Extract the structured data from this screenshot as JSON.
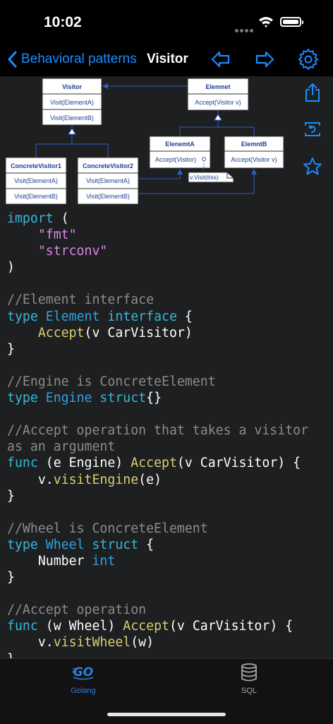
{
  "status_bar": {
    "time": "10:02"
  },
  "navbar": {
    "back_label": "Behavioral patterns",
    "title": "Visitor"
  },
  "diagram": {
    "visitor": {
      "name": "Visitor",
      "methods": [
        "Visit(ElementA)",
        "Visit(ElementB)"
      ]
    },
    "element": {
      "name": "Elemnet",
      "methods": [
        "Accept(Visitor v)"
      ]
    },
    "concrete_visitor1": {
      "name": "ConcreteVisitor1",
      "methods": [
        "Visit(ElementA)",
        "Visit(ElementB)"
      ]
    },
    "concrete_visitor2": {
      "name": "ConcreteVisitor2",
      "methods": [
        "Visit(ElementA)",
        "Visit(ElementB)"
      ]
    },
    "element_a": {
      "name": "ElenemtA",
      "methods": [
        "Accept(Visitor)"
      ]
    },
    "element_b": {
      "name": "ElemntB",
      "methods": [
        "Accept(Visitor v)"
      ]
    },
    "note": "v.Visit(this)"
  },
  "code": {
    "l1_kw": "import",
    "l1_rest": " (",
    "l2": "\"fmt\"",
    "l3": "\"strconv\"",
    "l4": ")",
    "l6": "//Element interface",
    "l7_kw": "type",
    "l7_name": "Element",
    "l7_kw2": "interface",
    "l7_rest": " {",
    "l8_fn": "Accept",
    "l8_rest": "(v CarVisitor)",
    "l9": "}",
    "l11": "//Engine is ConcreteElement",
    "l12_kw": "type",
    "l12_name": "Engine",
    "l12_kw2": "struct",
    "l12_rest": "{}",
    "l14": "//Accept operation that takes a visitor",
    "l15": "as an argument",
    "l16_kw": "func",
    "l16_a": " (e Engine) ",
    "l16_fn": "Accept",
    "l16_b": "(v CarVisitor) {",
    "l17_a": "v.",
    "l17_fn": "visitEngine",
    "l17_b": "(e)",
    "l18": "}",
    "l20": "//Wheel is ConcreteElement",
    "l21_kw": "type",
    "l21_name": "Wheel",
    "l21_kw2": "struct",
    "l21_rest": " {",
    "l22_a": "Number ",
    "l22_typ": "int",
    "l23": "}",
    "l25": "//Accept operation",
    "l26_kw": "func",
    "l26_a": " (w Wheel) ",
    "l26_fn": "Accept",
    "l26_b": "(v CarVisitor) {",
    "l27_a": "v.",
    "l27_fn": "visitWheel",
    "l27_b": "(w)",
    "l28": "}"
  },
  "tabs": [
    {
      "label": "Golang",
      "active": true
    },
    {
      "label": "SQL",
      "active": false
    }
  ],
  "colors": {
    "accent": "#1a8cff",
    "background": "#1e1f21",
    "bar": "#000000"
  }
}
